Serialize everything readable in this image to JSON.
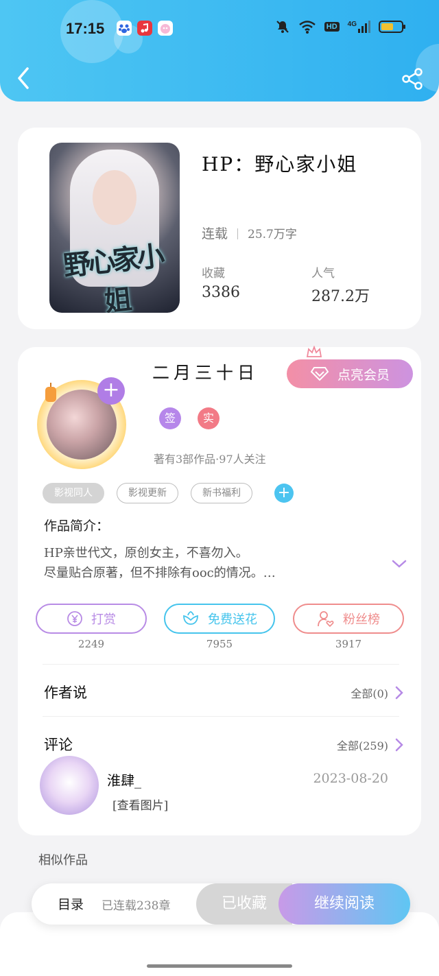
{
  "status_bar": {
    "time": "17:15",
    "network": "HD",
    "signal": "4G"
  },
  "book": {
    "title": "HP：野心家小姐",
    "status": "连载",
    "word_count": "25.7万字",
    "collect_label": "收藏",
    "collect_value": "3386",
    "popularity_label": "人气",
    "popularity_value": "287.2万",
    "cover_text": "野心家小姐"
  },
  "author": {
    "name": "二月三十日",
    "vip_button": "点亮会员",
    "badges": [
      {
        "label": "签",
        "color": "#b687ea"
      },
      {
        "label": "实",
        "color": "#f27a86"
      }
    ],
    "meta": "著有3部作品·97人关注",
    "tags": [
      "影视同人",
      "影视更新",
      "新书福利"
    ],
    "tag_add": "+",
    "avatar_add": "+"
  },
  "intro": {
    "label": "作品简介：",
    "line1": "HP亲世代文，原创女主，不喜勿入。",
    "line2": "尽量贴合原著，但不排除有ooc的情况。…"
  },
  "actions": [
    {
      "label": "打赏",
      "count": "2249",
      "color": "#b88be5"
    },
    {
      "label": "免费送花",
      "count": "7955",
      "color": "#45c4ec"
    },
    {
      "label": "粉丝榜",
      "count": "3917",
      "color": "#ef8c8c"
    }
  ],
  "author_says": {
    "title": "作者说",
    "link": "全部(0)"
  },
  "comments": {
    "title": "评论",
    "link": "全部(259)",
    "items": [
      {
        "user": "淮肆_",
        "date": "2023-08-20",
        "text": "[查看图片]"
      }
    ]
  },
  "similar_label": "相似作品",
  "bottom": {
    "toc": "目录",
    "chapter_count": "已连载238章",
    "favorited": "已收藏",
    "continue": "继续阅读"
  }
}
